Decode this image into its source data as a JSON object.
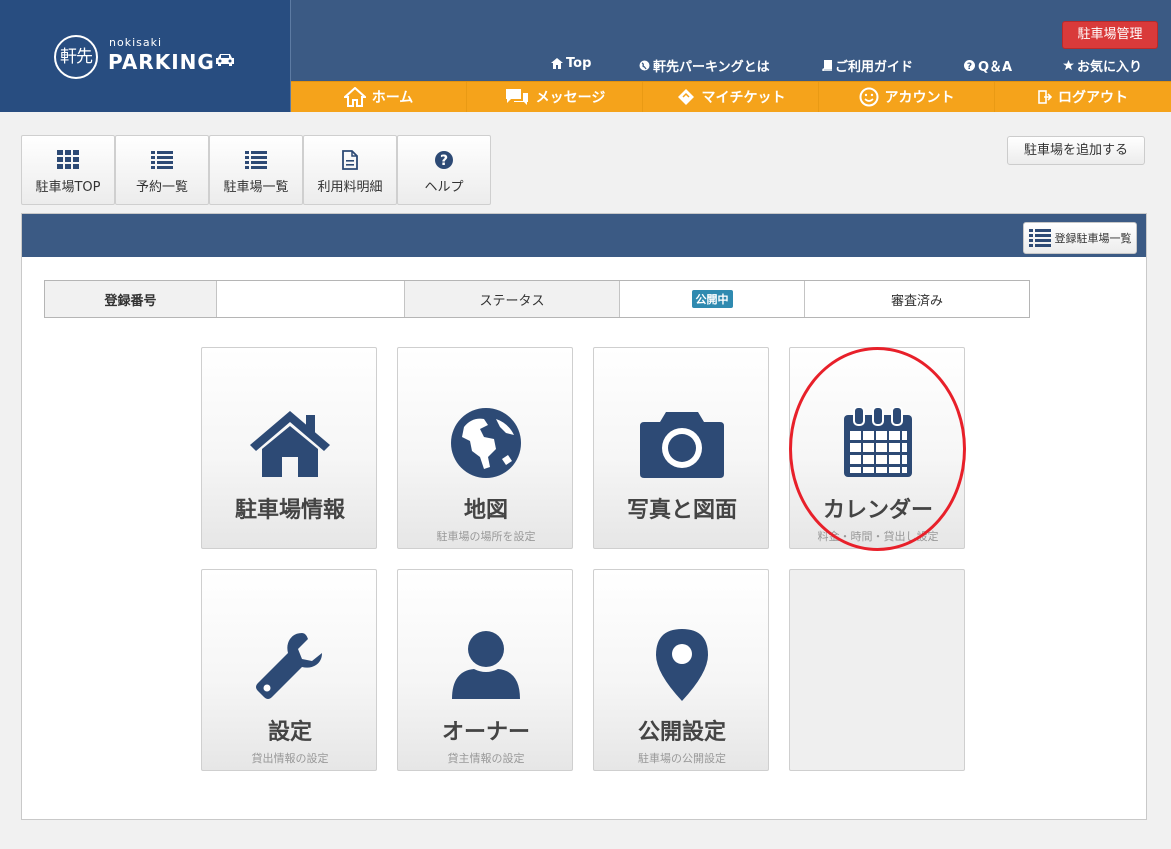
{
  "header": {
    "logo_mark": "軒先",
    "logo_small": "nokisaki",
    "logo_big": "PARKING",
    "admin_button": "駐車場管理",
    "topnav": [
      {
        "label": "Top",
        "icon": "home-icon"
      },
      {
        "label": "軒先パーキングとは",
        "icon": "globe-icon"
      },
      {
        "label": "ご利用ガイド",
        "icon": "book-icon"
      },
      {
        "label": "Q＆A",
        "icon": "question-icon"
      },
      {
        "label": "お気に入り",
        "icon": "star-icon"
      }
    ],
    "orange_nav": [
      {
        "label": "ホーム",
        "icon": "home-icon"
      },
      {
        "label": "メッセージ",
        "icon": "chat-icon"
      },
      {
        "label": "マイチケット",
        "icon": "ticket-icon"
      },
      {
        "label": "アカウント",
        "icon": "smile-icon"
      },
      {
        "label": "ログアウト",
        "icon": "logout-icon"
      }
    ]
  },
  "toolbar": {
    "buttons": [
      {
        "label": "駐車場TOP",
        "icon": "grid-icon"
      },
      {
        "label": "予約一覧",
        "icon": "list-icon"
      },
      {
        "label": "駐車場一覧",
        "icon": "list-icon"
      },
      {
        "label": "利用料明細",
        "icon": "document-icon"
      },
      {
        "label": "ヘルプ",
        "icon": "help-icon"
      }
    ],
    "add_button": "駐車場を追加する"
  },
  "panel": {
    "list_button": "登録駐車場一覧",
    "info": {
      "reg_label": "登録番号",
      "reg_value": "",
      "status_label": "ステータス",
      "status_badge": "公開中",
      "review": "審査済み"
    },
    "tiles": [
      {
        "title": "駐車場情報",
        "sub": "",
        "icon": "house-icon"
      },
      {
        "title": "地図",
        "sub": "駐車場の場所を設定",
        "icon": "globe-icon"
      },
      {
        "title": "写真と図面",
        "sub": "",
        "icon": "camera-icon"
      },
      {
        "title": "カレンダー",
        "sub": "料金・時間・貸出し設定",
        "icon": "calendar-icon"
      },
      {
        "title": "設定",
        "sub": "貸出情報の設定",
        "icon": "wrench-icon"
      },
      {
        "title": "オーナー",
        "sub": "貸主情報の設定",
        "icon": "user-icon"
      },
      {
        "title": "公開設定",
        "sub": "駐車場の公開設定",
        "icon": "map-pin-icon"
      }
    ]
  },
  "colors": {
    "navy": "#3b5a84",
    "orange": "#f5a31b",
    "red": "#d93a3a",
    "icon": "#2d4a75",
    "highlight": "#e8202a"
  }
}
